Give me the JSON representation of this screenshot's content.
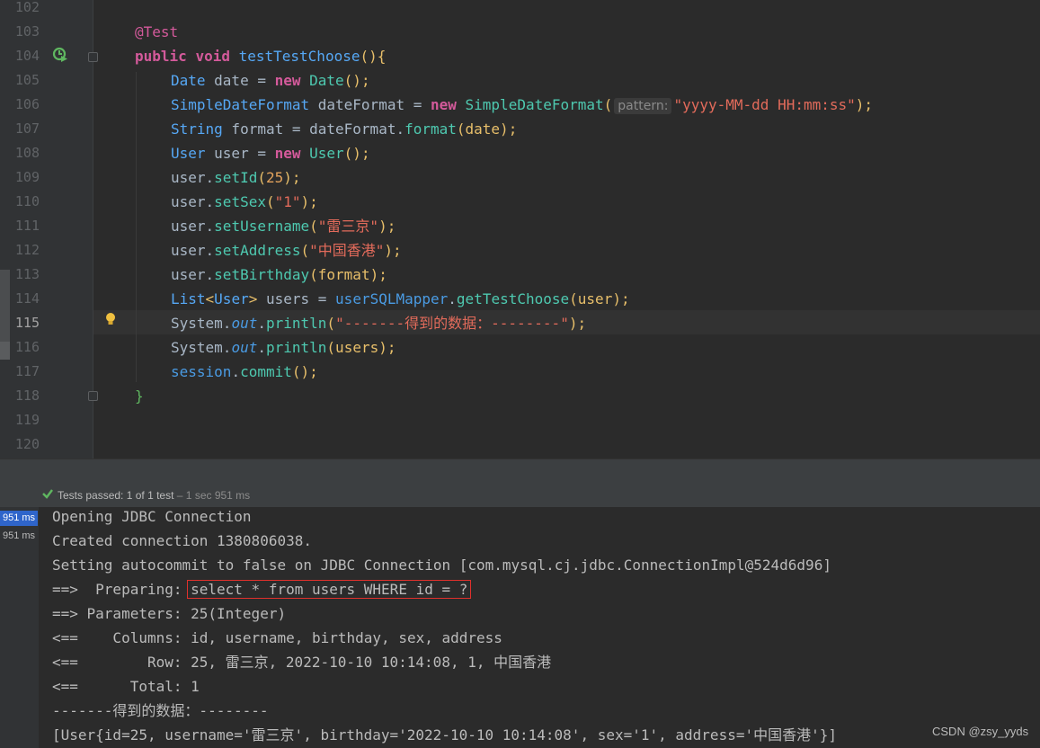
{
  "editor": {
    "line_numbers": [
      "102",
      "103",
      "104",
      "105",
      "106",
      "107",
      "108",
      "109",
      "110",
      "111",
      "112",
      "113",
      "114",
      "115",
      "116",
      "117",
      "118",
      "119",
      "120"
    ],
    "current_line": "115",
    "lines": {
      "l103": {
        "annotation": "@Test"
      },
      "l104": {
        "kw1": "public",
        "kw2": "void",
        "method": "testTestChoose",
        "rest": "(){"
      },
      "l105": {
        "type": "Date",
        "var": " date = ",
        "kw": "new",
        "ctor": " Date",
        "rest": "();"
      },
      "l106": {
        "type": "SimpleDateFormat",
        "var": " dateFormat = ",
        "kw": "new",
        "ctor": " SimpleDateFormat",
        "open": "(",
        "hint": "pattern:",
        "str": "\"yyyy-MM-dd HH:mm:ss\"",
        "rest": ");"
      },
      "l107": {
        "type": "String",
        "var": " format = dateFormat.",
        "call": "format",
        "rest": "(date);"
      },
      "l108": {
        "type": "User",
        "var": " user = ",
        "kw": "new",
        "ctor": " User",
        "rest": "();"
      },
      "l109": {
        "obj": "user.",
        "call": "setId",
        "open": "(",
        "num": "25",
        "rest": ");"
      },
      "l110": {
        "obj": "user.",
        "call": "setSex",
        "open": "(",
        "str": "\"1\"",
        "rest": ");"
      },
      "l111": {
        "obj": "user.",
        "call": "setUsername",
        "open": "(",
        "str": "\"雷三京\"",
        "rest": ");"
      },
      "l112": {
        "obj": "user.",
        "call": "setAddress",
        "open": "(",
        "str": "\"中国香港\"",
        "rest": ");"
      },
      "l113": {
        "obj": "user.",
        "call": "setBirthday",
        "rest": "(format);"
      },
      "l114": {
        "type": "List",
        "generic_open": "<",
        "gen": "User",
        "generic_close": ">",
        "var": " users = ",
        "field": "userSQLMapper",
        "dot": ".",
        "call": "getTestChoose",
        "rest": "(user);"
      },
      "l115": {
        "obj": "System.",
        "out": "out",
        "dot": ".",
        "call": "println",
        "open": "(",
        "str": "\"-------得到的数据：--------\"",
        "rest": ");"
      },
      "l116": {
        "obj": "System.",
        "out": "out",
        "dot": ".",
        "call": "println",
        "rest": "(users);"
      },
      "l117": {
        "field": "session",
        "dot": ".",
        "call": "commit",
        "rest": "();"
      },
      "l118": {
        "brace": "}"
      }
    }
  },
  "status": {
    "label": "Tests passed:",
    "count": "1",
    "of": "of 1 test",
    "duration": "– 1 sec 951 ms"
  },
  "console": {
    "badges": [
      "951 ms",
      "951 ms"
    ],
    "lines": {
      "c1": "Opening JDBC Connection",
      "c2": "Created connection 1380806038.",
      "c3": "Setting autocommit to false on JDBC Connection [com.mysql.cj.jdbc.ConnectionImpl@524d6d96]",
      "c4_prefix": "==>  Preparing: ",
      "c4_sql": "select * from users WHERE id = ?",
      "c5": "==> Parameters: 25(Integer)",
      "c6": "<==    Columns: id, username, birthday, sex, address",
      "c7": "<==        Row: 25, 雷三京, 2022-10-10 10:14:08, 1, 中国香港",
      "c8": "<==      Total: 1",
      "c9": "-------得到的数据：--------",
      "c10": "[User{id=25, username='雷三京', birthday='2022-10-10 10:14:08', sex='1', address='中国香港'}]"
    }
  },
  "watermark": "CSDN @zsy_yyds",
  "colors": {
    "accent": "#2f65ca",
    "highlight_box": "#e0302c",
    "pass_green": "#5fb760"
  }
}
